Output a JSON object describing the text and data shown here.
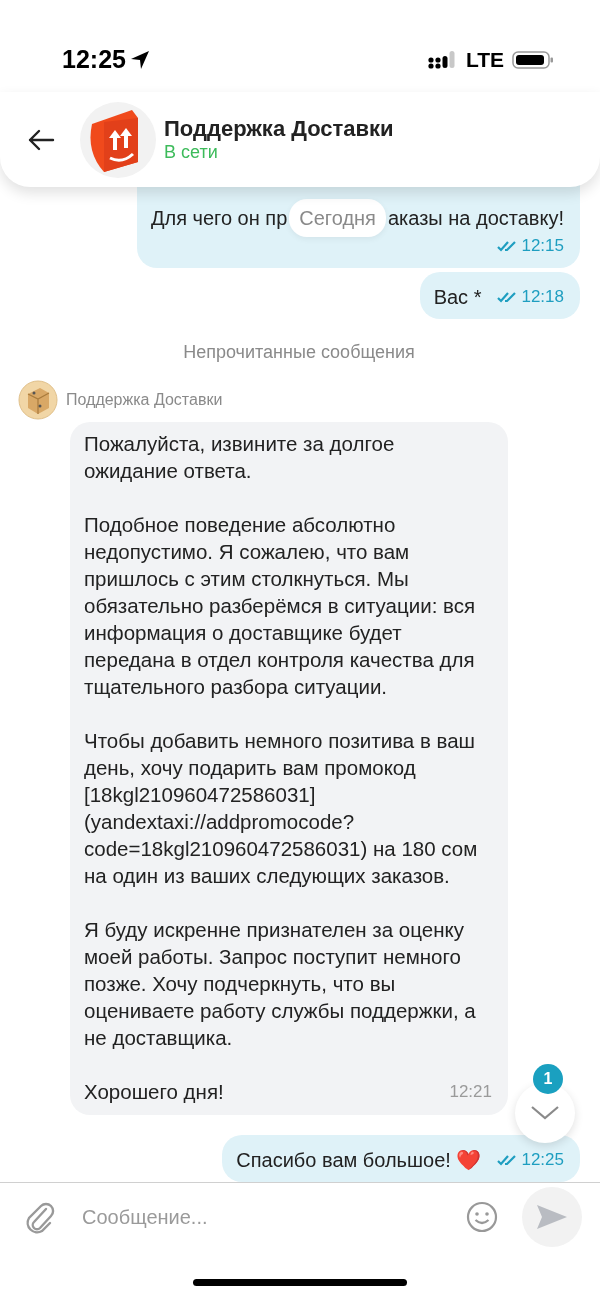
{
  "status_bar": {
    "time": "12:25",
    "network": "LTE"
  },
  "header": {
    "title": "Поддержка Доставки",
    "status": "В сети"
  },
  "date_divider": {
    "label": "Сегодня"
  },
  "messages": [
    {
      "kind": "outgoing",
      "lines": [
        [
          "Для чего он пр",
          "аказы на доставку!"
        ]
      ],
      "time": "12:15",
      "read": true
    },
    {
      "kind": "outgoing",
      "lines": [
        [
          "Вас *"
        ]
      ],
      "time": "12:18",
      "read": true
    },
    {
      "kind": "divider",
      "label": "Непрочитанные сообщения"
    },
    {
      "kind": "incoming",
      "sender": "Поддержка Доставки",
      "paragraphs": [
        "Пожалуйста, извините за долгое ожидание ответа.",
        "Подобное поведение абсолютно недопустимо. Я сожалею, что вам пришлось с этим столкнуться. Мы обязательно разберёмся в ситуации: вся информация о доставщике будет передана в отдел контроля качества для тщательного разбора ситуации.",
        "Чтобы добавить немного позитива в ваш день, хочу подарить вам промокод [18kgl210960472586031](yandextaxi://addpromocode?code=18kgl210960472586031) на 180 сом на один из ваших следующих заказов.",
        "Я буду искренне признателен за оценку моей работы. Запрос поступит немного позже. Хочу подчеркнуть, что вы оцениваете работу службы поддержки, а не доставщика.",
        "Хорошего дня!"
      ],
      "time": "12:21"
    },
    {
      "kind": "outgoing",
      "lines": [
        [
          "Спасибо вам большое! ❤️"
        ]
      ],
      "time": "12:25",
      "read": true
    }
  ],
  "scroll_button": {
    "badge": "1"
  },
  "composer": {
    "placeholder": "Сообщение..."
  }
}
